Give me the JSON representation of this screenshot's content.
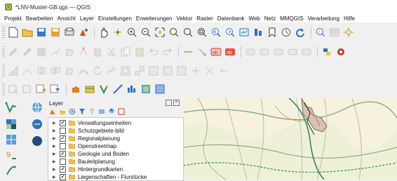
{
  "window": {
    "title": "*LNV-Muster-GB.qgs — QGIS"
  },
  "menu": [
    "Projekt",
    "Bearbeiten",
    "Ansicht",
    "Layer",
    "Einstellungen",
    "Erweiterungen",
    "Vektor",
    "Raster",
    "Datenbank",
    "Web",
    "Netz",
    "MMQGIS",
    "Verarbeitung",
    "Hilfe"
  ],
  "layers_panel": {
    "title": "Layer",
    "items": [
      {
        "label": "Verwaltungseinheiten",
        "checked": true,
        "check_mark": "✓"
      },
      {
        "label": "Schutzgebiete-bild",
        "checked": false,
        "check_mark": ""
      },
      {
        "label": "Regionalplanung",
        "checked": true,
        "check_mark": "✓"
      },
      {
        "label": "Openstreetmap",
        "checked": false,
        "check_mark": ""
      },
      {
        "label": "Geologie und Boden",
        "checked": true,
        "check_mark": "✓"
      },
      {
        "label": "Bauleitplanung",
        "checked": false,
        "check_mark": ""
      },
      {
        "label": "Hintergrundkarten",
        "checked": true,
        "check_mark": "✓"
      },
      {
        "label": "Liegenschaften - Flurstücke",
        "checked": true,
        "check_mark": "✓"
      }
    ]
  },
  "colors": {
    "accent_blue": "#2f6fc4",
    "folder_yellow": "#f2c14e",
    "map_background": "#f6f2dd",
    "map_line_red": "#c0392b",
    "map_line_green": "#2e8b57"
  },
  "icons": {
    "toolbar1": [
      "new-project-icon",
      "open-project-icon",
      "save-project-icon",
      "save-as-icon",
      "print-layout-icon",
      "style-manager-icon",
      "pan-icon",
      "pan-to-selection-icon",
      "zoom-in-icon",
      "zoom-out-icon",
      "zoom-full-icon",
      "zoom-to-selection-icon",
      "zoom-to-layer-icon",
      "zoom-native-icon",
      "zoom-last-icon",
      "zoom-next-icon",
      "new-map-view-icon",
      "bookmark-icon",
      "refresh-icon",
      "identify-icon",
      "attribute-table-icon",
      "settings-icon"
    ],
    "left_toolbar": [
      "add-vector-layer-icon",
      "add-raster-layer-icon",
      "add-mesh-layer-icon",
      "add-delimited-text-icon",
      "add-postgis-icon"
    ]
  }
}
